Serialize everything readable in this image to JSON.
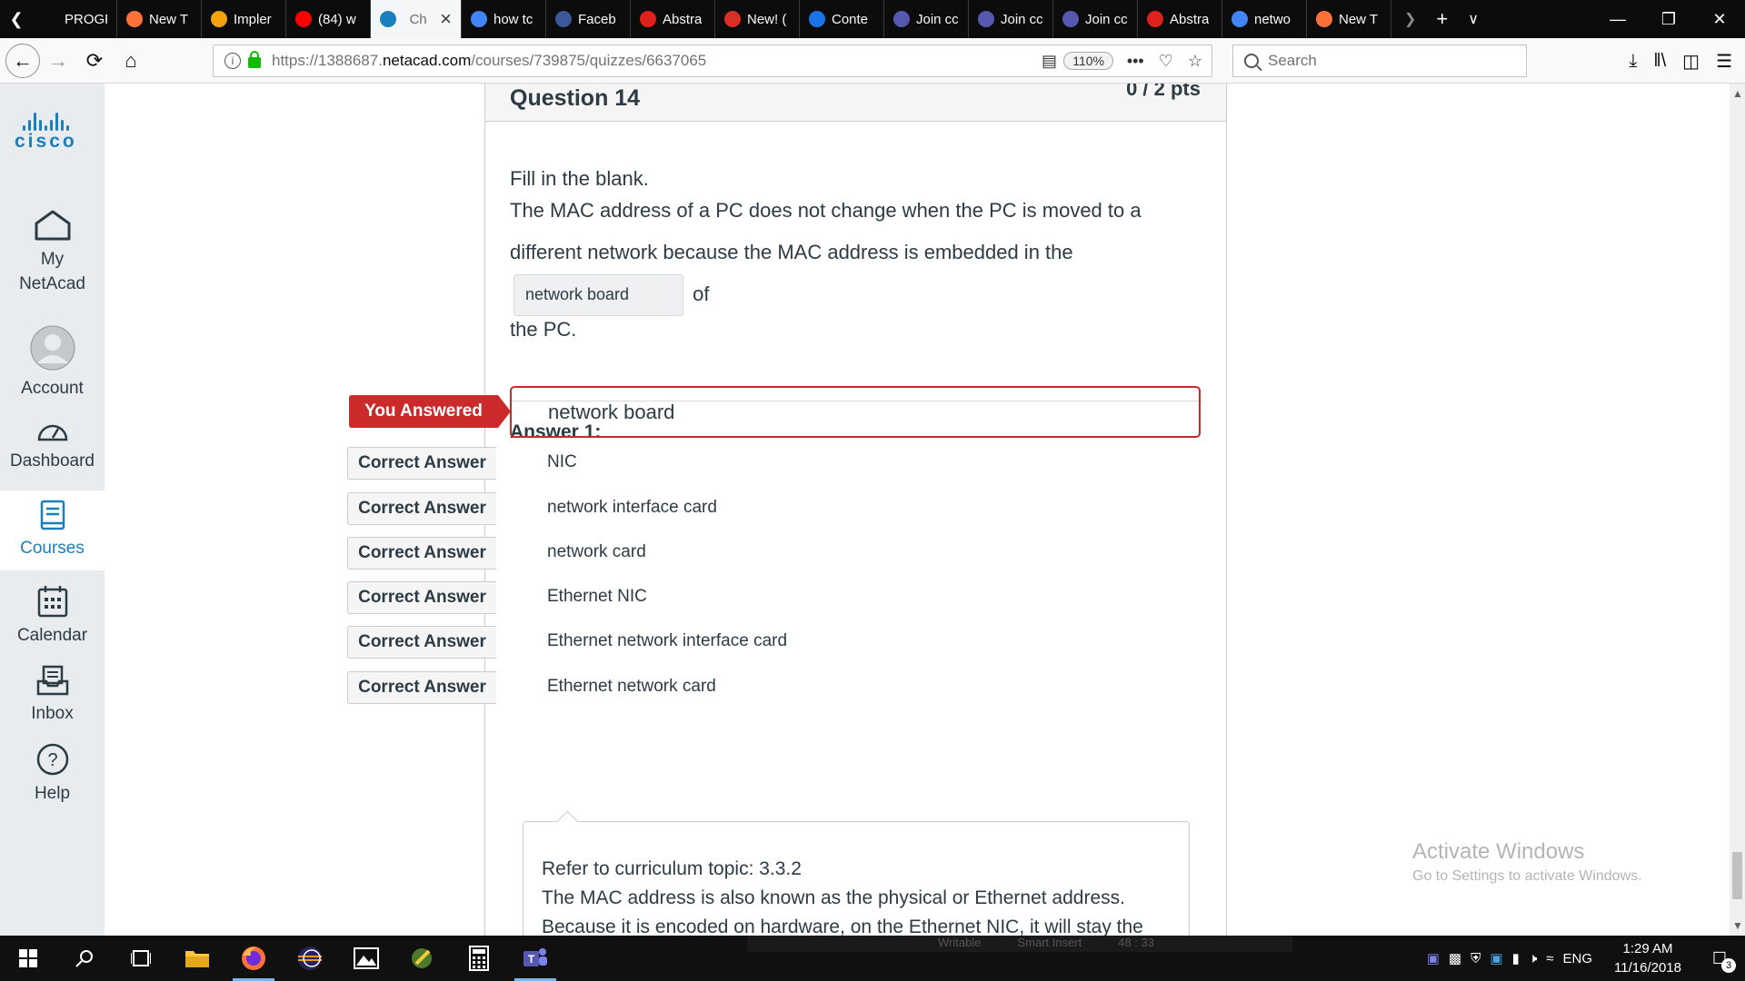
{
  "browser": {
    "tabs": [
      {
        "label": "PROGRAM",
        "icon": "blank-icon",
        "color": "#0c0c0d"
      },
      {
        "label": "New T",
        "icon": "firefox-icon",
        "color": "#ff7139"
      },
      {
        "label": "Impler",
        "icon": "app-icon",
        "color": "#f0a30a"
      },
      {
        "label": "(84) w",
        "icon": "youtube-icon",
        "color": "#ff0000"
      },
      {
        "label": "Ch",
        "icon": "cisco-icon",
        "color": "#1b7fbd",
        "active": true
      },
      {
        "label": "how tc",
        "icon": "google-icon",
        "color": "#4285f4"
      },
      {
        "label": "Faceb",
        "icon": "facebook-icon",
        "color": "#3b5998"
      },
      {
        "label": "Abstra",
        "icon": "oracle-icon",
        "color": "#e0201b"
      },
      {
        "label": "New! (",
        "icon": "gmail-icon",
        "color": "#d93025"
      },
      {
        "label": "Conte",
        "icon": "docs-icon",
        "color": "#1a73e8"
      },
      {
        "label": "Join cc",
        "icon": "teams-icon",
        "color": "#5558af"
      },
      {
        "label": "Join cc",
        "icon": "teams-icon",
        "color": "#5558af"
      },
      {
        "label": "Join cc",
        "icon": "teams-icon",
        "color": "#5558af"
      },
      {
        "label": "Abstra",
        "icon": "oracle-icon",
        "color": "#e0201b"
      },
      {
        "label": "netwo",
        "icon": "google-icon",
        "color": "#4285f4"
      },
      {
        "label": "New T",
        "icon": "firefox-icon",
        "color": "#ff7139"
      }
    ],
    "url_prefix": "https://1388687.",
    "url_domain": "netacad.com",
    "url_path": "/courses/739875/quizzes/6637065",
    "zoom": "110%",
    "search_placeholder": "Search"
  },
  "sidebar": {
    "logo_text": "cisco",
    "items": [
      {
        "label_line1": "My",
        "label_line2": "NetAcad",
        "icon": "home-icon"
      },
      {
        "label_line1": "Account",
        "icon": "account-icon"
      },
      {
        "label_line1": "Dashboard",
        "icon": "dashboard-icon"
      },
      {
        "label_line1": "Courses",
        "icon": "courses-icon",
        "active": true
      },
      {
        "label_line1": "Calendar",
        "icon": "calendar-icon"
      },
      {
        "label_line1": "Inbox",
        "icon": "inbox-icon"
      },
      {
        "label_line1": "Help",
        "icon": "help-icon"
      }
    ]
  },
  "question": {
    "title": "Question 14",
    "points": "0 / 2 pts",
    "instruction": "Fill in the blank.",
    "text_part1": "The MAC address of a PC does not change when the PC is moved to a different network because the MAC address is embedded in the",
    "blank_value": "network board",
    "text_part2": "of",
    "text_part3": "the PC.",
    "answer_label": "Answer 1:",
    "you_answered_tag": "You Answered",
    "you_answered_value": "network board",
    "correct_tag": "Correct Answer",
    "correct_answers": [
      "NIC",
      "network interface card",
      "network card",
      "Ethernet NIC",
      "Ethernet network interface card",
      "Ethernet network card"
    ],
    "comment_line1": "Refer to curriculum topic: 3.3.2",
    "comment_line2": "The MAC address is also known as the physical or Ethernet address.",
    "comment_line3": "Because it is encoded on hardware, on the Ethernet NIC, it will stay the"
  },
  "watermark": {
    "title": "Activate Windows",
    "subtitle": "Go to Settings to activate Windows."
  },
  "taskbar": {
    "strip_items": [
      "Writable",
      "Smart Insert",
      "48 : 33"
    ],
    "language": "ENG",
    "time": "1:29 AM",
    "date": "11/16/2018",
    "notifications": "3"
  },
  "colors": {
    "accent": "#1b7fbd",
    "wrong": "#cb2a2a"
  }
}
